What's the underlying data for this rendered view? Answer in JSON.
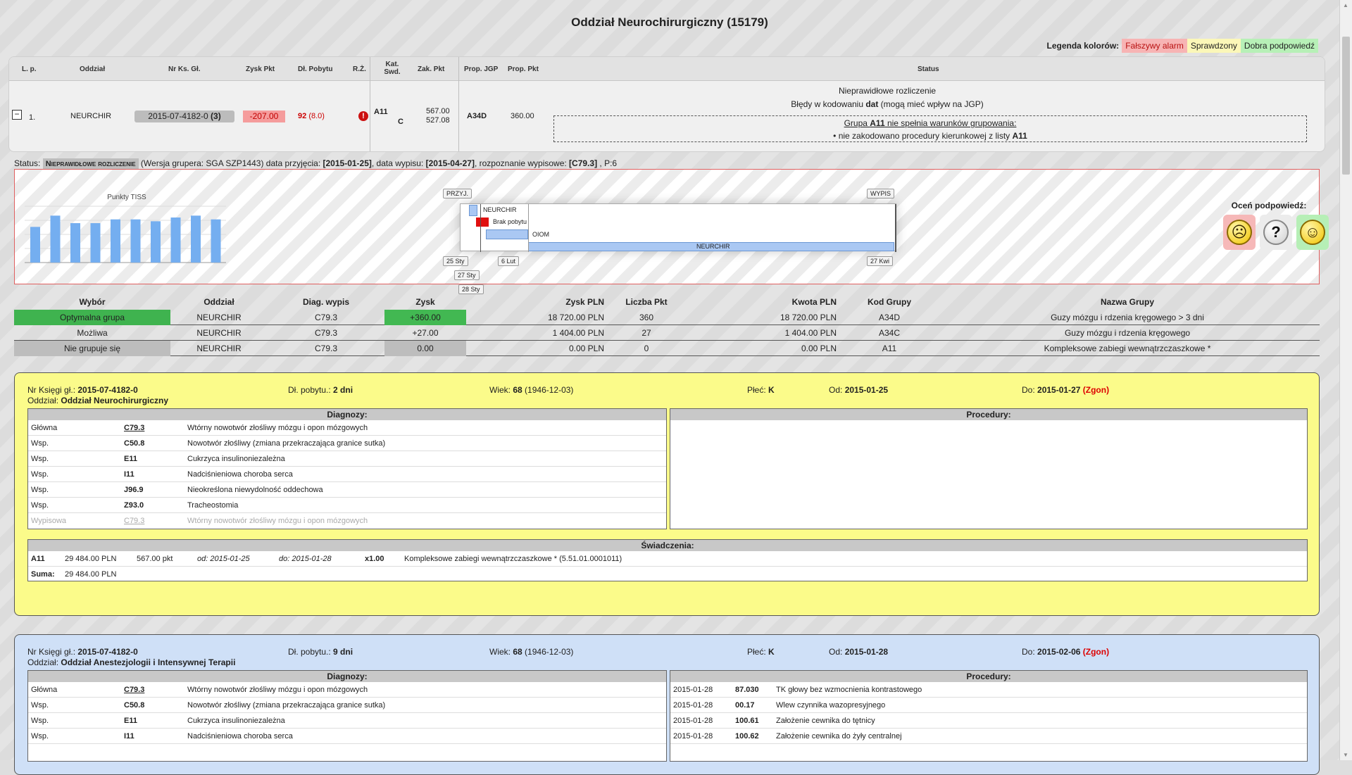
{
  "title": "Oddział Neurochirurgiczny (15179)",
  "legend": {
    "label": "Legenda kolorów:",
    "false_alarm": "Fałszywy alarm",
    "checked": "Sprawdzony",
    "good_hint": "Dobra podpowiedź",
    "colors": {
      "false_alarm": "#f7b4b4",
      "checked": "#fbf7b8",
      "good_hint": "#b7f0b7"
    }
  },
  "summary": {
    "headers": {
      "lp": "L. p.",
      "oddzial": "Oddział",
      "nr_ks": "Nr Ks. Gł.",
      "zysk": "Zysk Pkt",
      "dl": "Dł. Pobytu",
      "rz": "R.Ż.",
      "kat": "Kat. Swd.",
      "zak": "Zak. Pkt",
      "prop_jgp": "Prop. JGP",
      "prop_pkt": "Prop. Pkt",
      "status": "Status"
    },
    "row": {
      "toggle": "−",
      "lp": "1.",
      "oddzial": "NEURCHIR",
      "nr_ks": "2015-07-4182-0",
      "nr_ks_count": "(3)",
      "zysk": "-207.00",
      "dl": "92",
      "dl_sub": "(8.0)",
      "rz_icon": "!",
      "kat": "A11",
      "kat_sub": "C",
      "zak1": "567.00",
      "zak2": "527.08",
      "prop_jgp": "A34D",
      "prop_pkt": "360.00",
      "status_line1": "Nieprawidłowe rozliczenie",
      "status_line2a": "Błędy w kodowaniu ",
      "status_line2b": "dat",
      "status_line2c": " (mogą mieć wpływ na JGP)",
      "group_line1a": "Grupa ",
      "group_line1b": "A11",
      "group_line1c": " nie spełnia warunków grupowania:",
      "group_line2a": "• nie zakodowano procedury kierunkowej z listy ",
      "group_line2b": "A11"
    }
  },
  "statusline": {
    "label": "Status:",
    "pill": "Nieprawidłowe rozliczenie",
    "rest1": " (Wersja grupera: SGA SZP1443) data przyjęcia: ",
    "admit": "[2015-01-25]",
    "rest2": ", data wypisu: ",
    "discharge": "[2015-04-27]",
    "rest3": ", rozpoznanie wypisowe: ",
    "diag": "[C79.3]",
    "rest4": " , P:6"
  },
  "graph": {
    "tiss_title": "Punkty TISS",
    "tiss_values": [
      38,
      50,
      42,
      42,
      46,
      46,
      44,
      48,
      50,
      46
    ],
    "timeline": {
      "przyj": "PRZYJ.",
      "wypis": "WYPIS",
      "rows": [
        "NEURCHIR",
        "Brak pobytu",
        "OIOM",
        "NEURCHIR"
      ],
      "dates": [
        "25 Sty",
        "6 Lut",
        "27 Kwi",
        "27 Sty",
        "28 Sty"
      ]
    },
    "rate_title": "Oceń podpowiedź:",
    "rate_icons": [
      "sad-face-icon",
      "question-icon",
      "happy-face-icon"
    ]
  },
  "groups": {
    "headers": [
      "Wybór",
      "Oddział",
      "Diag. wypis",
      "Zysk",
      "Zysk PLN",
      "Liczba Pkt",
      "Kwota PLN",
      "Kod Grupy",
      "Nazwa Grupy"
    ],
    "rows": [
      {
        "wybor": "Optymalna grupa",
        "oddzial": "NEURCHIR",
        "diag": "C79.3",
        "zysk": "+360.00",
        "zysk_pln": "18 720.00 PLN",
        "pkt": "360",
        "kwota": "18 720.00 PLN",
        "kod": "A34D",
        "nazwa": "Guzy mózgu i rdzenia kręgowego > 3 dni"
      },
      {
        "wybor": "Możliwa",
        "oddzial": "NEURCHIR",
        "diag": "C79.3",
        "zysk": "+27.00",
        "zysk_pln": "1 404.00 PLN",
        "pkt": "27",
        "kwota": "1 404.00 PLN",
        "kod": "A34C",
        "nazwa": "Guzy mózgu i rdzenia kręgowego"
      },
      {
        "wybor": "Nie grupuje się",
        "oddzial": "NEURCHIR",
        "diag": "C79.3",
        "zysk": "0.00",
        "zysk_pln": "0.00 PLN",
        "pkt": "0",
        "kwota": "0.00 PLN",
        "kod": "A11",
        "nazwa": "Kompleksowe zabiegi wewnątrzczaszkowe *"
      }
    ]
  },
  "stay1": {
    "nr_label": "Nr Księgi gł.:",
    "nr": "2015-07-4182-0",
    "dl_label": "Dł. pobytu.:",
    "dl": "2 dni",
    "wiek_label": "Wiek:",
    "wiek": "68",
    "wiek_dob": "(1946-12-03)",
    "plec_label": "Płeć:",
    "plec": "K",
    "od_label": "Od:",
    "od": "2015-01-25",
    "do_label": "Do:",
    "do": "2015-01-27",
    "zgon": "(Zgon)",
    "oddzial_label": "Oddział:",
    "oddzial": "Oddział Neurochirurgiczny",
    "diag_header": "Diagnozy:",
    "proc_header": "Procedury:",
    "diagnoses": [
      {
        "type": "Główna",
        "code": "C79.3",
        "name": "Wtórny nowotwór złośliwy mózgu i opon mózgowych"
      },
      {
        "type": "Wsp.",
        "code": "C50.8",
        "name": "Nowotwór złośliwy (zmiana przekraczająca granice sutka)"
      },
      {
        "type": "Wsp.",
        "code": "E11",
        "name": "Cukrzyca insulinoniezależna"
      },
      {
        "type": "Wsp.",
        "code": "I11",
        "name": "Nadciśnieniowa choroba serca"
      },
      {
        "type": "Wsp.",
        "code": "J96.9",
        "name": "Nieokreślona niewydolność oddechowa"
      },
      {
        "type": "Wsp.",
        "code": "Z93.0",
        "name": "Tracheostomia"
      },
      {
        "type": "Wypisowa",
        "code": "C79.3",
        "name": "Wtórny nowotwór złośliwy mózgu i opon mózgowych"
      }
    ],
    "sw_header": "Świadczenia:",
    "sw": {
      "kod": "A11",
      "pln": "29 484.00 PLN",
      "pkt": "567.00 pkt",
      "od": "od: 2015-01-25",
      "do": "do: 2015-01-28",
      "mult": "x1.00",
      "name": "Kompleksowe zabiegi wewnątrzczaszkowe * (5.51.01.0001011)"
    },
    "suma_label": "Suma:",
    "suma": "29 484.00 PLN"
  },
  "stay2": {
    "nr_label": "Nr Księgi gł.:",
    "nr": "2015-07-4182-0",
    "dl_label": "Dł. pobytu.:",
    "dl": "9 dni",
    "wiek_label": "Wiek:",
    "wiek": "68",
    "wiek_dob": "(1946-12-03)",
    "plec_label": "Płeć:",
    "plec": "K",
    "od_label": "Od:",
    "od": "2015-01-28",
    "do_label": "Do:",
    "do": "2015-02-06",
    "zgon": "(Zgon)",
    "oddzial_label": "Oddział:",
    "oddzial": "Oddział Anestezjologii i Intensywnej Terapii",
    "diag_header": "Diagnozy:",
    "proc_header": "Procedury:",
    "diagnoses": [
      {
        "type": "Główna",
        "code": "C79.3",
        "name": "Wtórny nowotwór złośliwy mózgu i opon mózgowych"
      },
      {
        "type": "Wsp.",
        "code": "C50.8",
        "name": "Nowotwór złośliwy (zmiana przekraczająca granice sutka)"
      },
      {
        "type": "Wsp.",
        "code": "E11",
        "name": "Cukrzyca insulinoniezależna"
      },
      {
        "type": "Wsp.",
        "code": "I11",
        "name": "Nadciśnieniowa choroba serca"
      }
    ],
    "procedures": [
      {
        "date": "2015-01-28",
        "code": "87.030",
        "name": "TK głowy bez wzmocnienia kontrastowego"
      },
      {
        "date": "2015-01-28",
        "code": "00.17",
        "name": "Wlew czynnika wazopresyjnego"
      },
      {
        "date": "2015-01-28",
        "code": "100.61",
        "name": "Założenie cewnika do tętnicy"
      },
      {
        "date": "2015-01-28",
        "code": "100.62",
        "name": "Założenie cewnika do żyły centralnej"
      }
    ]
  }
}
